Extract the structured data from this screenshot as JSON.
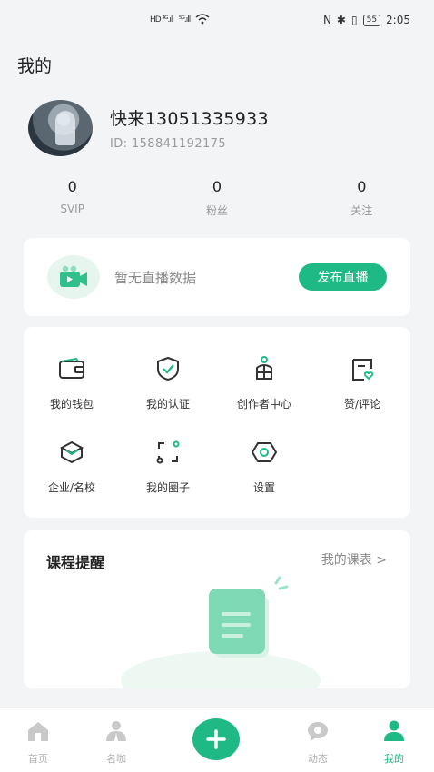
{
  "status_bar": {
    "network_1": "HD ⁴ᴳ.ıll",
    "network_2": "⁵ᴳ.ıll",
    "battery": "55",
    "time": "2:05"
  },
  "page": {
    "title": "我的"
  },
  "profile": {
    "username": "快来13051335933",
    "id_text": "ID:  158841192175"
  },
  "stats": [
    {
      "value": "0",
      "label": "SVIP"
    },
    {
      "value": "0",
      "label": "粉丝"
    },
    {
      "value": "0",
      "label": "关注"
    }
  ],
  "live": {
    "empty_text": "暂无直播数据",
    "button_label": "发布直播"
  },
  "menu": [
    {
      "label": "我的钱包",
      "icon": "wallet-icon"
    },
    {
      "label": "我的认证",
      "icon": "shield-check-icon"
    },
    {
      "label": "创作者中心",
      "icon": "creator-icon"
    },
    {
      "label": "赞/评论",
      "icon": "like-comment-icon"
    },
    {
      "label": "企业/名校",
      "icon": "building-icon"
    },
    {
      "label": "我的圈子",
      "icon": "circle-frame-icon"
    },
    {
      "label": "设置",
      "icon": "settings-icon"
    }
  ],
  "course": {
    "title": "课程提醒",
    "link": "我的课表 >"
  },
  "tabbar": [
    {
      "label": "首页",
      "icon": "home-icon"
    },
    {
      "label": "名咖",
      "icon": "people-icon"
    },
    {
      "label": "",
      "icon": "plus-icon"
    },
    {
      "label": "动态",
      "icon": "chat-icon"
    },
    {
      "label": "我的",
      "icon": "user-icon"
    }
  ],
  "colors": {
    "accent": "#1fb985",
    "background": "#f3f4f6"
  }
}
